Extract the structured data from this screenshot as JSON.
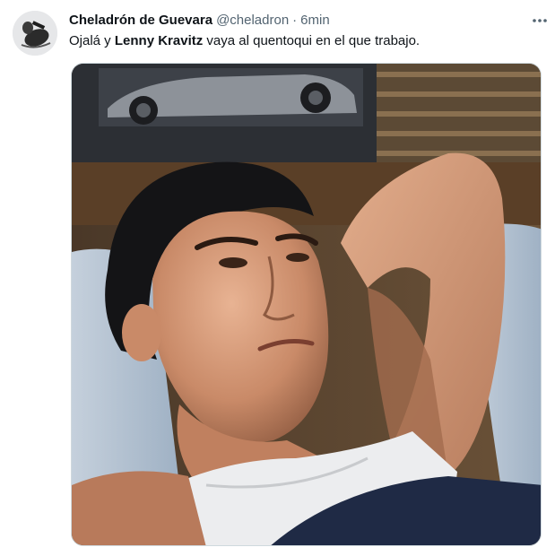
{
  "tweet": {
    "author": {
      "display_name": "Cheladrón de Guevara",
      "handle": "@cheladron"
    },
    "separator": "·",
    "time": "6min",
    "text": {
      "part1": "Ojalá y ",
      "bold1": "Lenny",
      "part2": " ",
      "bold2": "Kravitz",
      "part3": " vaya al quentoqui en el que trabajo."
    },
    "icons": {
      "more": "more-horizontal-icon",
      "avatar": "profile-avatar"
    }
  },
  "colors": {
    "text_primary": "#0f1419",
    "text_secondary": "#536471",
    "border": "#cfd9de"
  }
}
